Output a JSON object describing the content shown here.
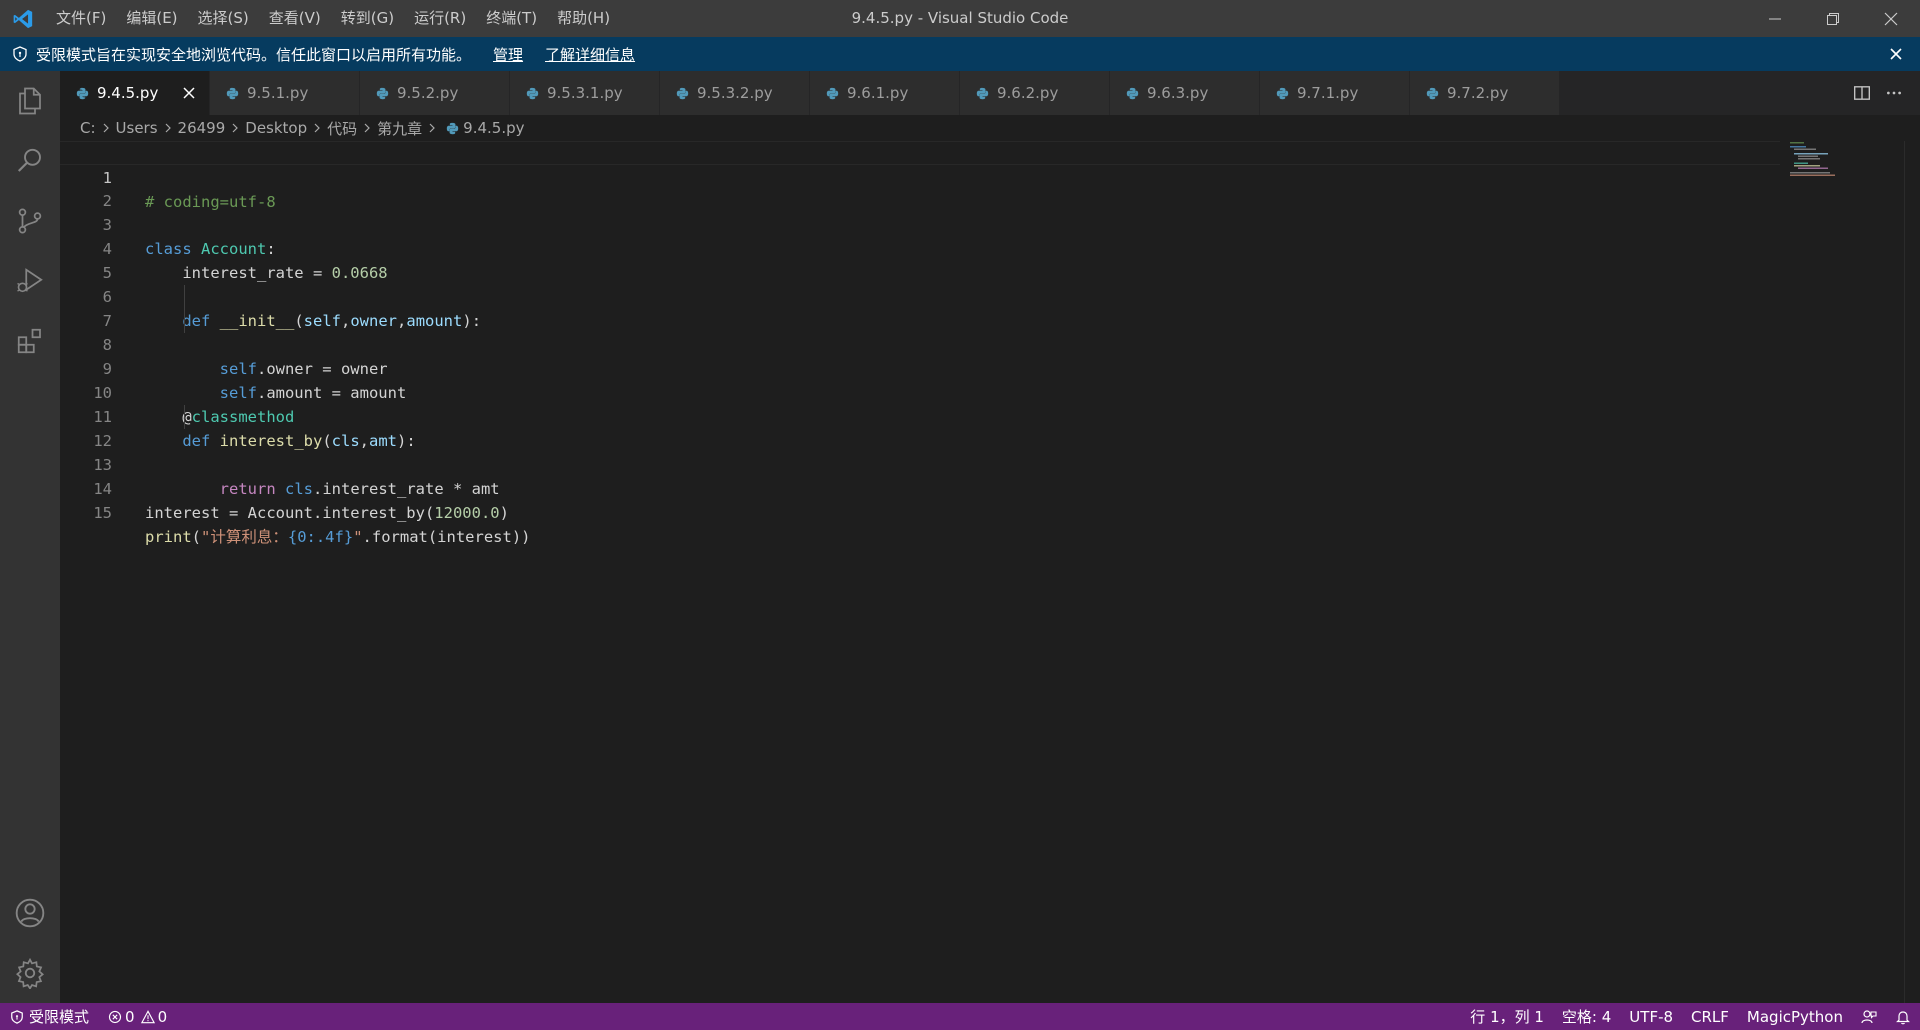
{
  "window": {
    "title": "9.4.5.py - Visual Studio Code"
  },
  "menu": [
    "文件(F)",
    "编辑(E)",
    "选择(S)",
    "查看(V)",
    "转到(G)",
    "运行(R)",
    "终端(T)",
    "帮助(H)"
  ],
  "banner": {
    "text": "受限模式旨在实现安全地浏览代码。信任此窗口以启用所有功能。",
    "manage": "管理",
    "learn_more": "了解详细信息"
  },
  "tabs": [
    "9.4.5.py",
    "9.5.1.py",
    "9.5.2.py",
    "9.5.3.1.py",
    "9.5.3.2.py",
    "9.6.1.py",
    "9.6.2.py",
    "9.6.3.py",
    "9.7.1.py",
    "9.7.2.py"
  ],
  "active_tab": "9.4.5.py",
  "breadcrumb": [
    "C:",
    "Users",
    "26499",
    "Desktop",
    "代码",
    "第九章",
    "9.4.5.py"
  ],
  "editor": {
    "line_numbers": [
      "1",
      "2",
      "3",
      "4",
      "5",
      "6",
      "7",
      "8",
      "9",
      "10",
      "11",
      "12",
      "13",
      "14",
      "15"
    ],
    "active_line": "1"
  },
  "status": {
    "restricted": "受限模式",
    "errors": "0",
    "warnings": "0",
    "position": "行 1，列 1",
    "spaces": "空格: 4",
    "encoding": "UTF-8",
    "eol": "CRLF",
    "language": "MagicPython"
  },
  "colors": {
    "titlebar": "#3c3c3c",
    "banner": "#063b5f",
    "statusbar": "#68217a",
    "editor": "#1e1e1e",
    "python_icon": "#519aba"
  },
  "icons": [
    "vscode-logo-icon",
    "explorer-icon",
    "search-icon",
    "source-control-icon",
    "run-debug-icon",
    "extensions-icon",
    "account-icon",
    "gear-icon",
    "python-file-icon",
    "split-editor-icon",
    "more-actions-icon",
    "shield-icon",
    "error-icon",
    "warning-icon",
    "feedback-icon",
    "bell-icon"
  ]
}
